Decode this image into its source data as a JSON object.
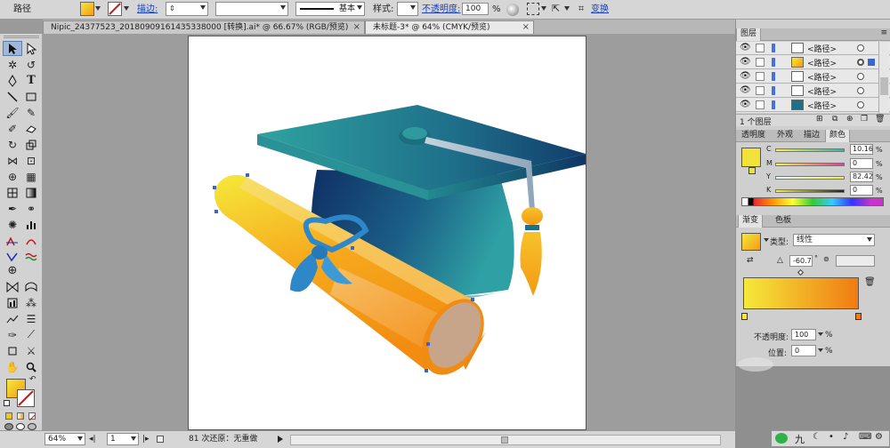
{
  "control_bar": {
    "object_type": "路径",
    "stroke_label": "描边:",
    "stroke_style": "基本",
    "style_label": "样式:",
    "opacity_label": "不透明度:",
    "opacity_value": "100",
    "opacity_unit": "%",
    "transform_label": "变换"
  },
  "doc_tabs": [
    {
      "label": "Nipic_24377523_20180909161435338000 [转换].ai* @ 66.67% (RGB/预览)",
      "close": "×"
    },
    {
      "label": "未标题-3* @ 64% (CMYK/预览)",
      "close": "×"
    }
  ],
  "status_bar": {
    "zoom": "64%",
    "page": "1",
    "undo_info": "81 次还原：无重做"
  },
  "layers_panel": {
    "title": "图层",
    "items": [
      {
        "name": "<路径>"
      },
      {
        "name": "<路径>"
      },
      {
        "name": "<路径>"
      },
      {
        "name": "<路径>"
      },
      {
        "name": "<路径>"
      }
    ],
    "count": "1 个图层"
  },
  "color_panel": {
    "tabs": [
      "透明度",
      "外观",
      "描边",
      "颜色"
    ],
    "channels": [
      {
        "name": "C",
        "value": "10.16"
      },
      {
        "name": "M",
        "value": "0"
      },
      {
        "name": "Y",
        "value": "82.42"
      },
      {
        "name": "K",
        "value": "0"
      }
    ],
    "unit": "%"
  },
  "gradient_panel": {
    "tabs": [
      "渐变",
      "色板"
    ],
    "type_label": "类型:",
    "type_value": "线性",
    "angle": "-60.7",
    "angle_unit": "°",
    "opacity_label": "不透明度:",
    "opacity_value": "100",
    "position_label": "位置:",
    "position_value": "0",
    "unit": "%"
  },
  "colors": {
    "fill_yellow": "#f2e23a",
    "fill_orange": "#f3a21c",
    "cap_teal": "#2e9d9d",
    "cap_navy": "#13386a"
  },
  "taskbar_glyph": "九"
}
